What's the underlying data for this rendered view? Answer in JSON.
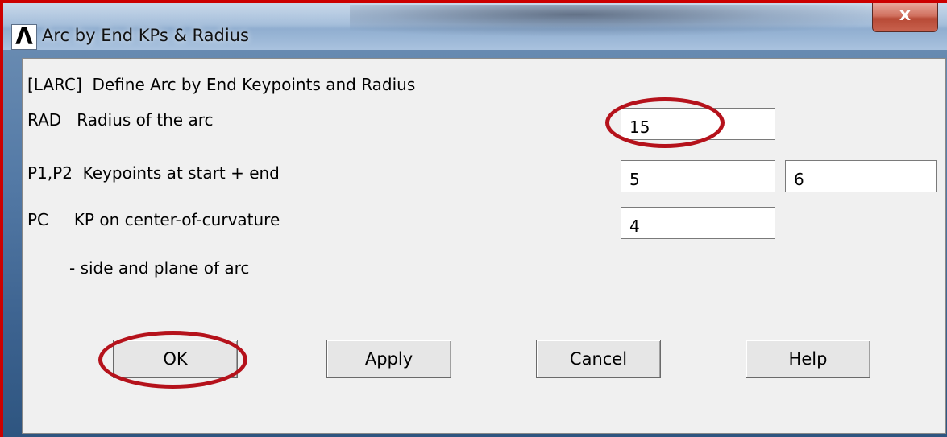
{
  "window": {
    "title": "Arc by End KPs & Radius",
    "logo_glyph": "Λ",
    "close_glyph": "x"
  },
  "dialog": {
    "heading": "[LARC]  Define Arc by End Keypoints and Radius",
    "rad": {
      "label": "RAD   Radius of the arc",
      "value": "15"
    },
    "p1p2": {
      "label": "P1,P2  Keypoints at start + end",
      "value1": "5",
      "value2": "6"
    },
    "pc": {
      "label": "PC     KP on center-of-curvature",
      "value": "4"
    },
    "pc_note": "- side and plane of arc"
  },
  "buttons": {
    "ok": "OK",
    "apply": "Apply",
    "cancel": "Cancel",
    "help": "Help"
  },
  "annotations": {
    "highlight_color": "#b5121b",
    "circled": [
      "rad-value",
      "ok-button"
    ]
  },
  "colors": {
    "border_accent": "#cc0000",
    "dialog_bg": "#f0f0f0"
  }
}
